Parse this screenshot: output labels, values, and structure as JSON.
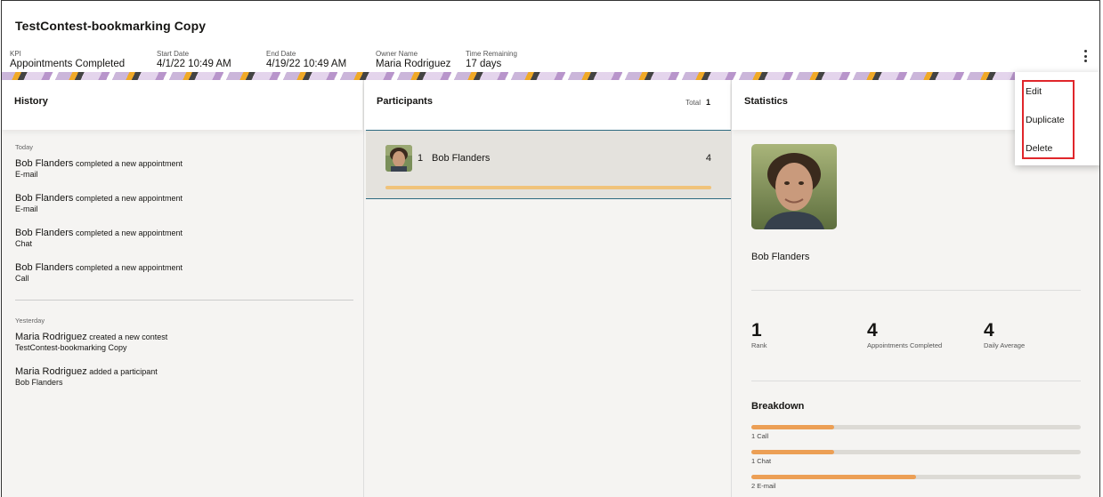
{
  "header": {
    "title": "TestContest-bookmarking Copy",
    "meta": [
      {
        "label": "KPI",
        "value": "Appointments Completed"
      },
      {
        "label": "Start Date",
        "value": "4/1/22 10:49 AM"
      },
      {
        "label": "End Date",
        "value": "4/19/22 10:49 AM"
      },
      {
        "label": "Owner Name",
        "value": "Maria Rodriguez"
      },
      {
        "label": "Time Remaining",
        "value": "17 days"
      }
    ]
  },
  "menu": {
    "items": [
      {
        "label": "Edit"
      },
      {
        "label": "Duplicate"
      },
      {
        "label": "Delete"
      }
    ]
  },
  "history": {
    "title": "History",
    "groups": [
      {
        "label": "Today",
        "items": [
          {
            "who": "Bob Flanders",
            "action": "completed a new appointment",
            "detail": "E-mail"
          },
          {
            "who": "Bob Flanders",
            "action": "completed a new appointment",
            "detail": "E-mail"
          },
          {
            "who": "Bob Flanders",
            "action": "completed a new appointment",
            "detail": "Chat"
          },
          {
            "who": "Bob Flanders",
            "action": "completed a new appointment",
            "detail": "Call"
          }
        ]
      },
      {
        "label": "Yesterday",
        "items": [
          {
            "who": "Maria Rodriguez",
            "action": "created a new contest",
            "detail": "TestContest-bookmarking Copy"
          },
          {
            "who": "Maria Rodriguez",
            "action": "added a participant",
            "detail": "Bob Flanders"
          }
        ]
      }
    ]
  },
  "participants": {
    "title": "Participants",
    "total_label": "Total",
    "total": "1",
    "rows": [
      {
        "rank": "1",
        "name": "Bob Flanders",
        "score": "4",
        "progress": 1.0
      }
    ]
  },
  "statistics": {
    "title": "Statistics",
    "name": "Bob Flanders",
    "stats": [
      {
        "value": "1",
        "label": "Rank"
      },
      {
        "value": "4",
        "label": "Appointments Completed"
      },
      {
        "value": "4",
        "label": "Daily Average"
      }
    ],
    "breakdown_title": "Breakdown",
    "breakdown": [
      {
        "label": "1 Call",
        "fraction": 0.25
      },
      {
        "label": "1 Chat",
        "fraction": 0.25
      },
      {
        "label": "2 E-mail",
        "fraction": 0.5
      }
    ]
  },
  "colors": {
    "accent_bar": "#f0c37a",
    "breakdown_fill": "#ec9f55",
    "selected_border": "#2e6b80",
    "menu_highlight": "#e0262b"
  }
}
